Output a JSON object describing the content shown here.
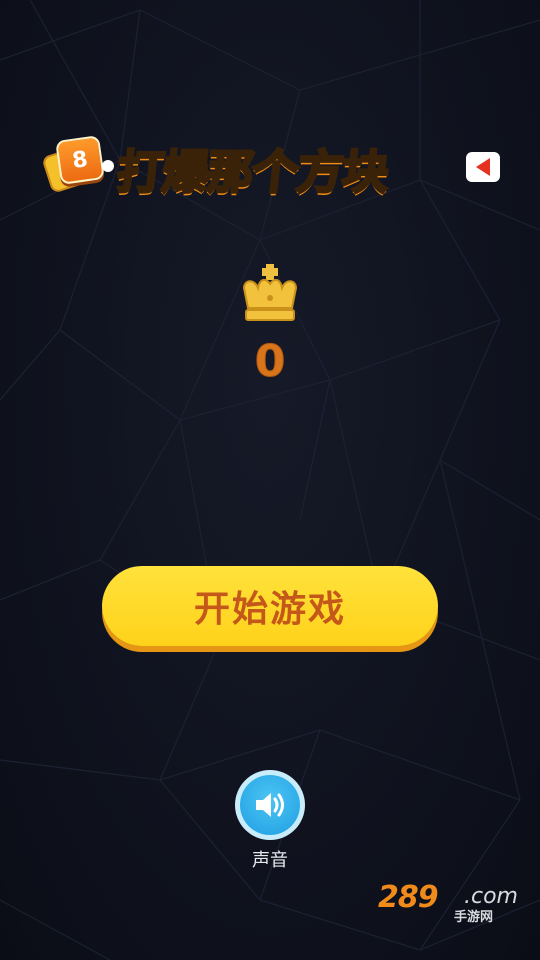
{
  "title": {
    "badge_number": "8",
    "text": "打爆那个方块"
  },
  "best": {
    "icon": "crown-icon",
    "score": "0"
  },
  "start_button": {
    "label": "开始游戏"
  },
  "sound": {
    "icon": "speaker-icon",
    "label": "声音"
  },
  "watermark": {
    "number": "289",
    "domain": ".com",
    "subtitle": "手游网"
  },
  "colors": {
    "background": "#0f1320",
    "title_fill": "#ffcf2a",
    "score": "#d8741a",
    "start_button": "#ffd21a",
    "start_text": "#c4571a",
    "sound_button": "#1f9fe2"
  }
}
